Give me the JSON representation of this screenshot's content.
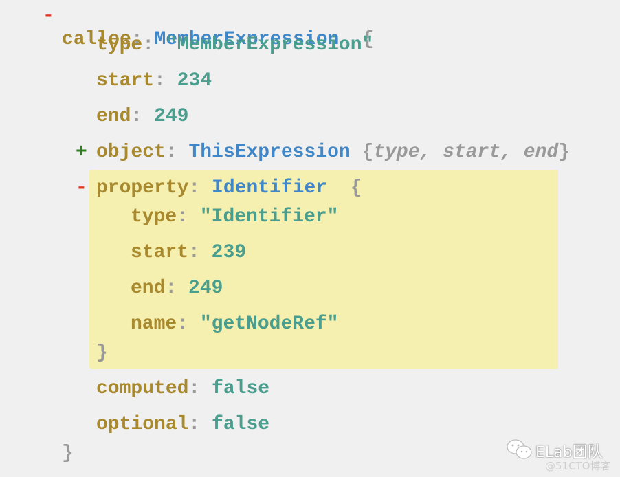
{
  "tree": {
    "callee": {
      "key": "callee",
      "type_name": "MemberExpression",
      "toggle": "-",
      "open": "{",
      "close": "}"
    },
    "callee_type": {
      "key": "type",
      "value": "\"MemberExpression\""
    },
    "callee_start": {
      "key": "start",
      "value": "234"
    },
    "callee_end": {
      "key": "end",
      "value": "249"
    },
    "object": {
      "key": "object",
      "type_name": "ThisExpression",
      "toggle": "+",
      "summary_open": "{",
      "summary_fields": "type, start, end",
      "summary_close": "}"
    },
    "property": {
      "key": "property",
      "type_name": "Identifier",
      "toggle": "-",
      "open": "{",
      "close": "}",
      "highlighted": true
    },
    "property_type": {
      "key": "type",
      "value": "\"Identifier\""
    },
    "property_start": {
      "key": "start",
      "value": "239"
    },
    "property_end": {
      "key": "end",
      "value": "249"
    },
    "property_name": {
      "key": "name",
      "value": "\"getNodeRef\""
    },
    "computed": {
      "key": "computed",
      "value": "false"
    },
    "optional": {
      "key": "optional",
      "value": "false"
    },
    "colon": ":"
  },
  "watermark": {
    "brand": "ELab团队",
    "source": "@51CTO博客",
    "icon": "wechat-icon"
  },
  "colors": {
    "key": "#a8892e",
    "type": "#3f87c8",
    "value": "#4a9e8e",
    "punct": "#999999",
    "collapse": "#e8351f",
    "expand": "#2e7d1e",
    "highlight": "#f5efb0",
    "background": "#f0f0f0"
  }
}
